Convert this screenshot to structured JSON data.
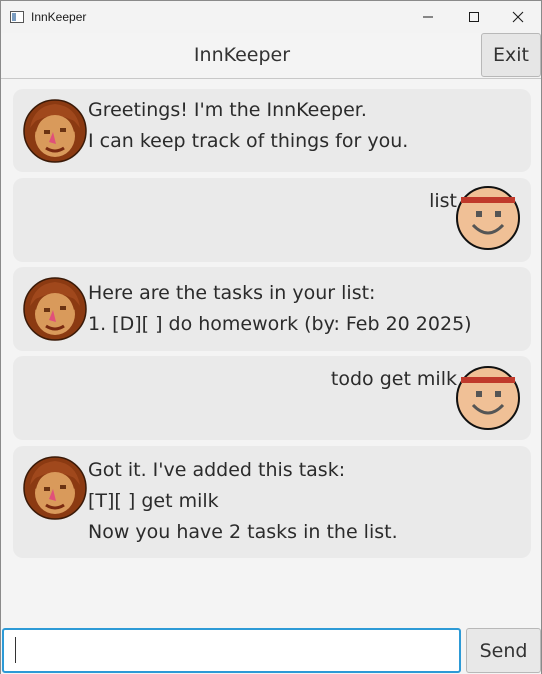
{
  "window": {
    "title": "InnKeeper"
  },
  "header": {
    "title": "InnKeeper",
    "exit_label": "Exit"
  },
  "dialog": [
    {
      "speaker": "bot",
      "avatar": "innkeeper-avatar",
      "lines": [
        "Greetings! I'm the InnKeeper.",
        "I can keep track of things for you."
      ]
    },
    {
      "speaker": "user",
      "avatar": "user-smiley-avatar",
      "lines": [
        "list"
      ]
    },
    {
      "speaker": "bot",
      "avatar": "innkeeper-avatar",
      "lines": [
        "Here are the tasks in your list:",
        "1. [D][ ] do homework (by: Feb 20 2025)"
      ]
    },
    {
      "speaker": "user",
      "avatar": "user-smiley-avatar",
      "lines": [
        "todo get milk"
      ]
    },
    {
      "speaker": "bot",
      "avatar": "innkeeper-avatar",
      "lines": [
        "Got it. I've added this task:",
        "[T][ ] get milk",
        "Now you have 2 tasks in the list."
      ]
    }
  ],
  "input": {
    "value": "",
    "send_label": "Send"
  },
  "colors": {
    "accent": "#2d9ad6",
    "bubble": "#eaeaea",
    "background": "#f4f4f4"
  }
}
